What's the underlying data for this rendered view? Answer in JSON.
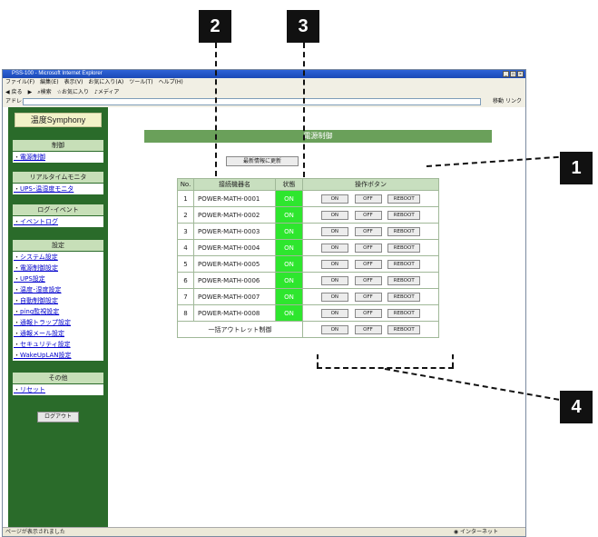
{
  "callouts": [
    "2",
    "3",
    "1",
    "4"
  ],
  "browser": {
    "title": "PSS-100 - Microsoft Internet Explorer",
    "menu": [
      "ファイル(F)",
      "編集(E)",
      "表示(V)",
      "お気に入り(A)",
      "ツール(T)",
      "ヘルプ(H)"
    ],
    "toolbar": [
      "戻る",
      "検索",
      "お気に入り",
      "メディア"
    ],
    "address_label": "アドレス(D)",
    "go_label": "移動",
    "links_label": "リンク",
    "status_text": "ページが表示されました",
    "zone_text": "インターネット"
  },
  "sidebar": {
    "logo": "温度Symphony",
    "sections": [
      {
        "head": "制御",
        "items": [
          "電源制御"
        ]
      },
      {
        "head": "リアルタイムモニタ",
        "items": [
          "UPS･温湿度モニタ"
        ]
      },
      {
        "head": "ログ･イベント",
        "items": [
          "イベントログ"
        ]
      },
      {
        "head": "設定",
        "items": [
          "システム設定",
          "電源制御設定",
          "UPS設定",
          "温度･湿度設定",
          "自動制御設定",
          "ping監視設定",
          "通報トラップ設定",
          "通報メール設定",
          "セキュリティ設定",
          "WakeUpLAN設定"
        ]
      },
      {
        "head": "その他",
        "items": [
          "リセット"
        ]
      }
    ],
    "logout_label": "ログアウト"
  },
  "main": {
    "title": "電源制御",
    "refresh_label": "最新情報に更新",
    "table": {
      "headers": [
        "No.",
        "接続機器名",
        "状態",
        "操作ボタン"
      ],
      "rows": [
        {
          "no": "1",
          "name": "POWER-MATH-0001",
          "status": "ON"
        },
        {
          "no": "2",
          "name": "POWER-MATH-0002",
          "status": "ON"
        },
        {
          "no": "3",
          "name": "POWER-MATH-0003",
          "status": "ON"
        },
        {
          "no": "4",
          "name": "POWER-MATH-0004",
          "status": "ON"
        },
        {
          "no": "5",
          "name": "POWER-MATH-0005",
          "status": "ON"
        },
        {
          "no": "6",
          "name": "POWER-MATH-0006",
          "status": "ON"
        },
        {
          "no": "7",
          "name": "POWER-MATH-0007",
          "status": "ON"
        },
        {
          "no": "8",
          "name": "POWER-MATH-0008",
          "status": "ON"
        }
      ],
      "bulk_label": "一括アウトレット制御",
      "btn_on": "ON",
      "btn_off": "OFF",
      "btn_reboot": "REBOOT"
    }
  },
  "colors": {
    "sidebar": "#2a6b2a",
    "header": "#6aa05a",
    "status_on": "#2ee62e",
    "table_head": "#c8dfbf"
  }
}
